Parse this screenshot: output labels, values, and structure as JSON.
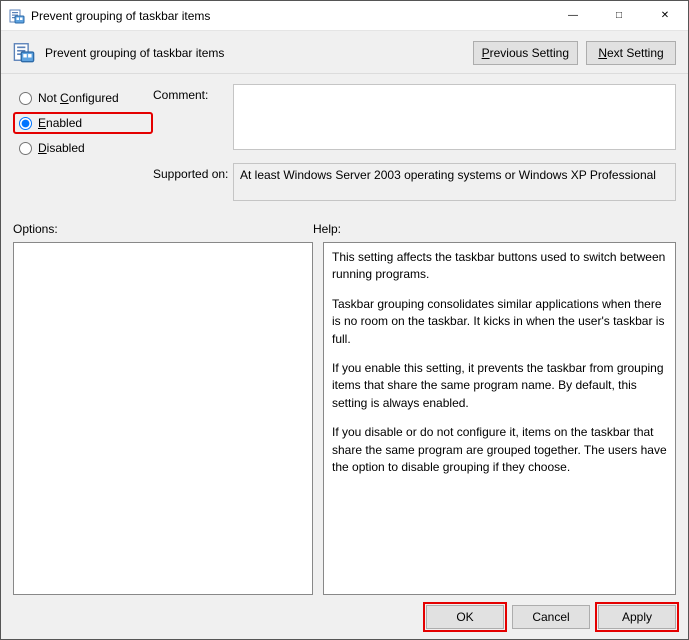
{
  "window": {
    "title": "Prevent grouping of taskbar items",
    "subtitle": "Prevent grouping of taskbar items",
    "nav": {
      "prev": "Previous Setting",
      "next": "Next Setting"
    }
  },
  "state": {
    "not_configured": "Not Configured",
    "enabled": "Enabled",
    "disabled": "Disabled",
    "selected": "enabled"
  },
  "comment": {
    "label": "Comment:",
    "value": ""
  },
  "supported": {
    "label": "Supported on:",
    "value": "At least Windows Server 2003 operating systems or Windows XP Professional"
  },
  "options": {
    "label": "Options:"
  },
  "help": {
    "label": "Help:",
    "paragraphs": [
      "This setting affects the taskbar buttons used to switch between running programs.",
      "Taskbar grouping consolidates similar applications when there is no room on the taskbar. It kicks in when the user's taskbar is full.",
      "If you enable this setting, it prevents the taskbar from grouping items that share the same program name. By default, this setting is always enabled.",
      "If you disable or do not configure it, items on the taskbar that share the same program are grouped together. The users have the option to disable grouping if they choose."
    ]
  },
  "footer": {
    "ok": "OK",
    "cancel": "Cancel",
    "apply": "Apply"
  }
}
